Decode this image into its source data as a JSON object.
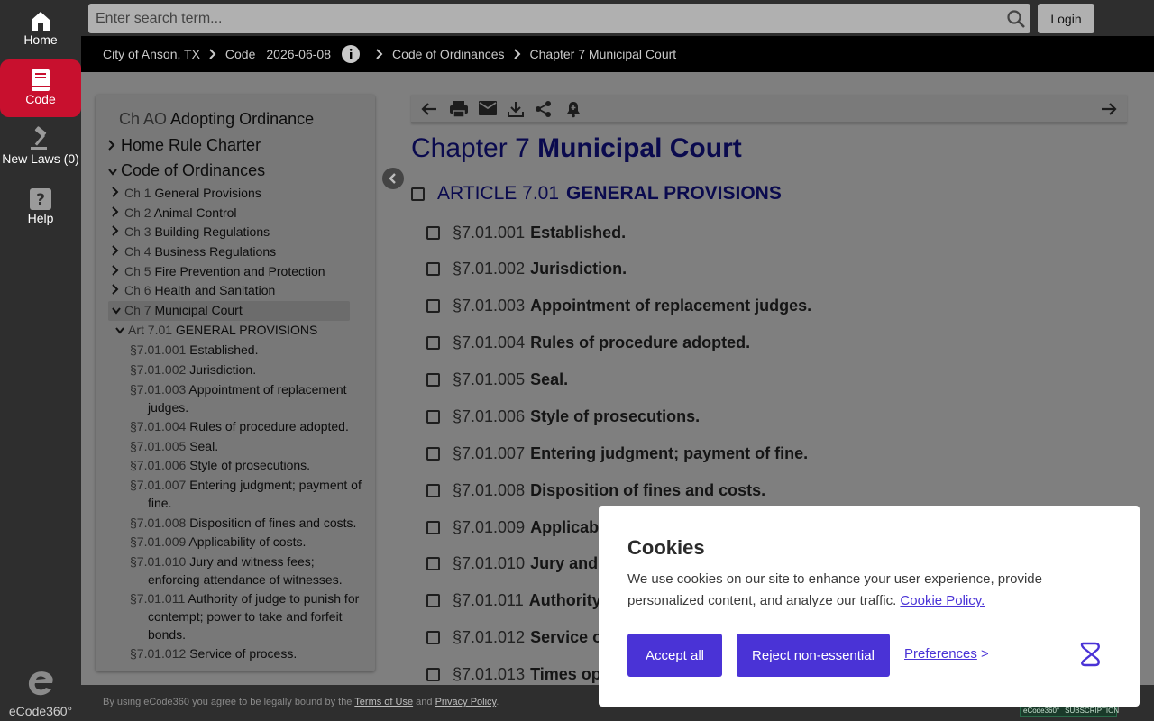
{
  "sidebar": {
    "items": [
      {
        "label": "Home",
        "icon": "home-icon"
      },
      {
        "label": "Code",
        "icon": "book-icon"
      },
      {
        "label": "New Laws (0)",
        "icon": "gavel-icon"
      },
      {
        "label": "Help",
        "icon": "help-icon"
      }
    ],
    "brand": "eCode360°"
  },
  "header": {
    "search_placeholder": "Enter search term...",
    "login_label": "Login"
  },
  "breadcrumb": {
    "city": "City of Anson, TX",
    "code": "Code",
    "date": "2026-06-08",
    "ordinances": "Code of Ordinances",
    "chapter": "Chapter 7 Municipal Court"
  },
  "toc": {
    "top": [
      {
        "num": "Ch AO",
        "title": "Adopting Ordinance"
      },
      {
        "num": "",
        "title": "Home Rule Charter"
      },
      {
        "num": "",
        "title": "Code of Ordinances"
      }
    ],
    "chapters": [
      {
        "num": "Ch 1",
        "title": "General Provisions"
      },
      {
        "num": "Ch 2",
        "title": "Animal Control"
      },
      {
        "num": "Ch 3",
        "title": "Building Regulations"
      },
      {
        "num": "Ch 4",
        "title": "Business Regulations"
      },
      {
        "num": "Ch 5",
        "title": "Fire Prevention and Protection"
      },
      {
        "num": "Ch 6",
        "title": "Health and Sanitation"
      },
      {
        "num": "Ch 7",
        "title": "Municipal Court"
      }
    ],
    "article": {
      "num": "Art 7.01",
      "title": "GENERAL PROVISIONS"
    },
    "sections": [
      {
        "num": "§7.01.001",
        "title": "Established."
      },
      {
        "num": "§7.01.002",
        "title": "Jurisdiction."
      },
      {
        "num": "§7.01.003",
        "title": "Appointment of replacement judges."
      },
      {
        "num": "§7.01.004",
        "title": "Rules of procedure adopted."
      },
      {
        "num": "§7.01.005",
        "title": "Seal."
      },
      {
        "num": "§7.01.006",
        "title": "Style of prosecutions."
      },
      {
        "num": "§7.01.007",
        "title": "Entering judgment; payment of fine."
      },
      {
        "num": "§7.01.008",
        "title": "Disposition of fines and costs."
      },
      {
        "num": "§7.01.009",
        "title": "Applicability of costs."
      },
      {
        "num": "§7.01.010",
        "title": "Jury and witness fees; enforcing attendance of witnesses."
      },
      {
        "num": "§7.01.011",
        "title": "Authority of judge to punish for contempt; power to take and forfeit bonds."
      },
      {
        "num": "§7.01.012",
        "title": "Service of process."
      }
    ]
  },
  "main": {
    "chapter_num": "Chapter 7",
    "chapter_title": "Municipal Court",
    "article_num": "ARTICLE 7.01",
    "article_title": "GENERAL PROVISIONS",
    "sections": [
      {
        "num": "§7.01.001",
        "title": "Established."
      },
      {
        "num": "§7.01.002",
        "title": "Jurisdiction."
      },
      {
        "num": "§7.01.003",
        "title": "Appointment of replacement judges."
      },
      {
        "num": "§7.01.004",
        "title": "Rules of procedure adopted."
      },
      {
        "num": "§7.01.005",
        "title": "Seal."
      },
      {
        "num": "§7.01.006",
        "title": "Style of prosecutions."
      },
      {
        "num": "§7.01.007",
        "title": "Entering judgment; payment of fine."
      },
      {
        "num": "§7.01.008",
        "title": "Disposition of fines and costs."
      },
      {
        "num": "§7.01.009",
        "title": "Applicab"
      },
      {
        "num": "§7.01.010",
        "title": "Jury and"
      },
      {
        "num": "§7.01.011",
        "title": "Authority"
      },
      {
        "num": "§7.01.012",
        "title": "Service o"
      },
      {
        "num": "§7.01.013",
        "title": "Times op"
      }
    ]
  },
  "footer": {
    "prefix": "By using eCode360 you agree to be legally bound by the",
    "terms": "Terms of Use",
    "and": "and",
    "privacy": "Privacy Policy",
    "end": ".",
    "badge_left": "eCode360°",
    "badge_right": "SUBSCRIPTION"
  },
  "cookie": {
    "title": "Cookies",
    "text": "We use cookies on our site to enhance your user experience, provide personalized content, and analyze our traffic.",
    "policy_link": "Cookie Policy.",
    "accept": "Accept all",
    "reject": "Reject non-essential",
    "preferences": "Preferences",
    "preferences_arrow": ">"
  },
  "colors": {
    "accent_red": "#c8102e",
    "cookie_purple": "#4a33d6",
    "heading_navy": "#0a0a4e"
  }
}
